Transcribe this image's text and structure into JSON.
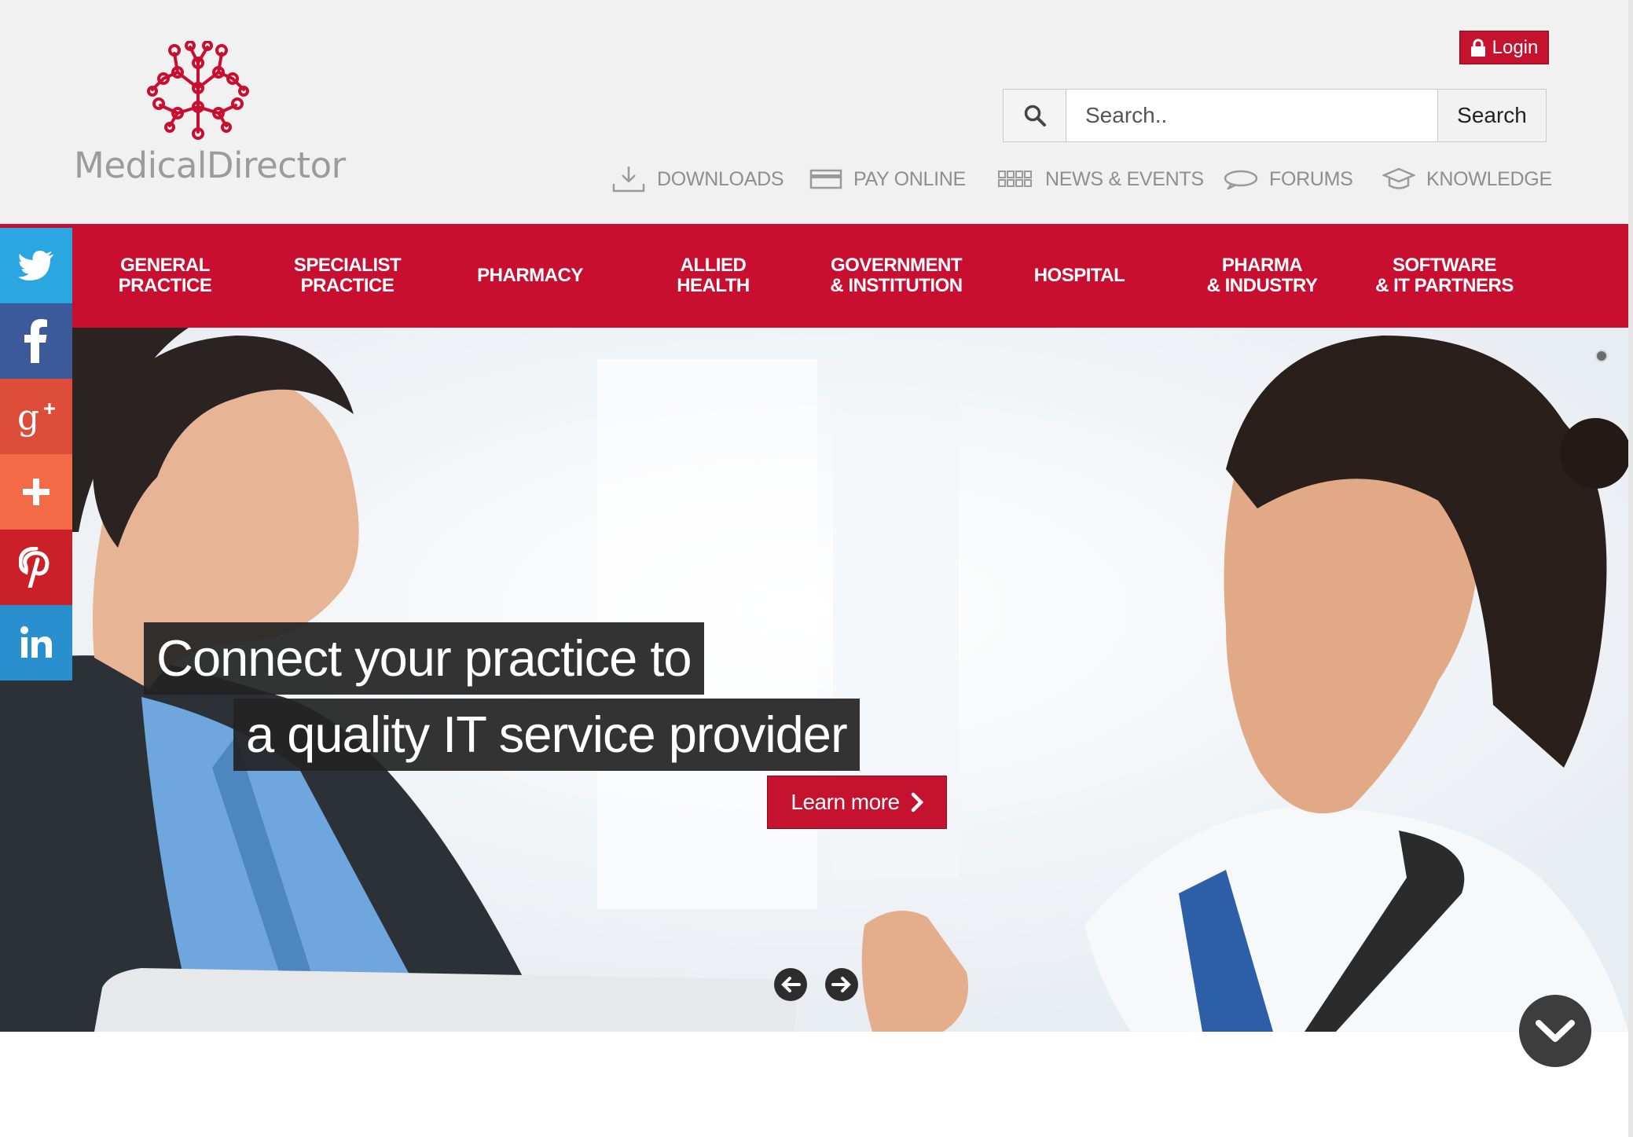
{
  "brand": {
    "name": "MedicalDirector",
    "logo_icon": "network-tree-icon",
    "accent_color": "#c80f30"
  },
  "login": {
    "label": "Login",
    "icon": "lock-icon"
  },
  "search": {
    "placeholder": "Search..",
    "button_label": "Search",
    "icon": "search-icon"
  },
  "utility_links": [
    {
      "label": "DOWNLOADS",
      "icon": "download-icon"
    },
    {
      "label": "PAY ONLINE",
      "icon": "credit-card-icon"
    },
    {
      "label": "NEWS & EVENTS",
      "icon": "grid-icon"
    },
    {
      "label": "FORUMS",
      "icon": "speech-bubble-icon"
    },
    {
      "label": "KNOWLEDGE",
      "icon": "graduation-cap-icon"
    }
  ],
  "nav": [
    {
      "label": "GENERAL\nPRACTICE"
    },
    {
      "label": "SPECIALIST\nPRACTICE"
    },
    {
      "label": "PHARMACY"
    },
    {
      "label": "ALLIED\nHEALTH"
    },
    {
      "label": "GOVERNMENT\n& INSTITUTION"
    },
    {
      "label": "HOSPITAL"
    },
    {
      "label": "PHARMA\n& INDUSTRY"
    },
    {
      "label": "SOFTWARE\n& IT PARTNERS"
    }
  ],
  "social": [
    {
      "name": "twitter",
      "icon": "twitter-icon",
      "color": "#2aa7e0"
    },
    {
      "name": "facebook",
      "icon": "facebook-icon",
      "color": "#3c5a9a"
    },
    {
      "name": "google-plus",
      "icon": "google-plus-icon",
      "color": "#dd4b39"
    },
    {
      "name": "share",
      "icon": "plus-icon",
      "color": "#f26a46"
    },
    {
      "name": "pinterest",
      "icon": "pinterest-icon",
      "color": "#cb2027"
    },
    {
      "name": "linkedin",
      "icon": "linkedin-icon",
      "color": "#2a8fce"
    }
  ],
  "hero": {
    "caption_line1": "Connect your practice to",
    "caption_line2": "a quality IT service provider",
    "cta_label": "Learn more",
    "cta_icon": "chevron-right-icon",
    "prev_icon": "arrow-left-icon",
    "next_icon": "arrow-right-icon"
  },
  "scroll_down_icon": "chevron-down-icon"
}
